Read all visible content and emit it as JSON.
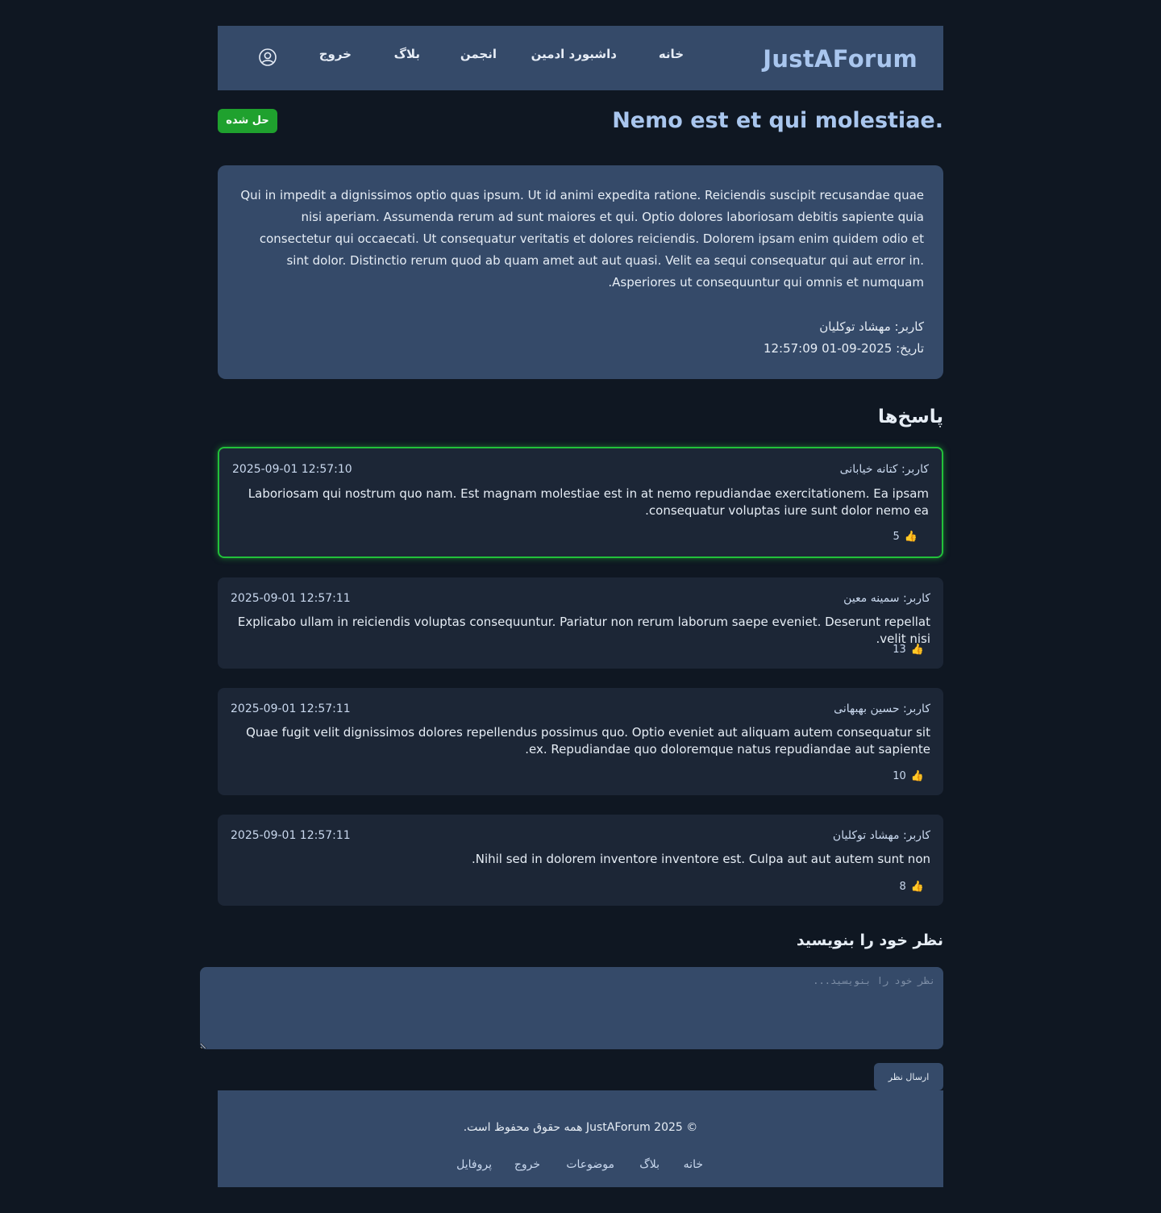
{
  "header": {
    "brand": "JustAForum",
    "nav": [
      "خانه",
      "داشبورد ادمین",
      "انجمن",
      "بلاگ",
      "خروج"
    ],
    "profile_icon": "user-circle-icon"
  },
  "topic": {
    "title": ".Nemo est et qui molestiae",
    "status_badge": "حل شده",
    "body": "Qui in impedit a dignissimos optio quas ipsum. Ut id animi expedita ratione. Reiciendis suscipit recusandae quae nisi aperiam. Assumenda rerum ad sunt maiores et qui. Optio dolores laboriosam debitis sapiente quia consectetur qui occaecati. Ut consequatur veritatis et dolores reiciendis. Dolorem ipsam enim quidem odio et sint dolor. Distinctio rerum quod ab quam amet aut aut quasi. Velit ea sequi consequatur qui aut error in. Asperiores ut consequuntur qui omnis et numquam.",
    "author": "کاربر: مهشاد توکلیان",
    "date": "تاریخ: 2025-09-01 12:57:09"
  },
  "replies_title": "پاسخ‌ها",
  "replies": [
    {
      "author": "کاربر: کتانه خیابانی",
      "date": "2025-09-01 12:57:10",
      "text": "Laboriosam qui nostrum quo nam. Est magnam molestiae est in at nemo repudiandae exercitationem. Ea ipsam consequatur voluptas iure sunt dolor nemo ea.",
      "likes": "5",
      "accepted": true
    },
    {
      "author": "کاربر: سمینه معین",
      "date": "2025-09-01 12:57:11",
      "text": "Explicabo ullam in reiciendis voluptas consequuntur. Pariatur non rerum laborum saepe eveniet. Deserunt repellat velit nisi.",
      "likes": "13",
      "accepted": false
    },
    {
      "author": "کاربر: حسین بهبهانی",
      "date": "2025-09-01 12:57:11",
      "text": "Quae fugit velit dignissimos dolores repellendus possimus quo. Optio eveniet aut aliquam autem consequatur sit ex. Repudiandae quo doloremque natus repudiandae aut sapiente.",
      "likes": "10",
      "accepted": false
    },
    {
      "author": "کاربر: مهشاد توکلیان",
      "date": "2025-09-01 12:57:11",
      "text": "Nihil sed in dolorem inventore inventore est. Culpa aut aut autem sunt non.",
      "likes": "8",
      "accepted": false
    }
  ],
  "comment_form": {
    "title": "نظر خود را بنویسید",
    "placeholder": "نظر خود را بنویسید...",
    "value": "",
    "submit_label": "ارسال نظر"
  },
  "footer": {
    "copyright": "© 2025 JustAForum همه حقوق محفوظ است.",
    "links": [
      "خانه",
      "بلاگ",
      "موضوعات",
      "خروج",
      "پروفایل"
    ]
  },
  "colors": {
    "background": "#0f1722",
    "panel": "#354a69",
    "card": "#1c2636",
    "brand": "#a9c6ee",
    "accepted_border": "#22c03a",
    "badge": "#1fa12e",
    "like_icon": "#f4b400"
  }
}
